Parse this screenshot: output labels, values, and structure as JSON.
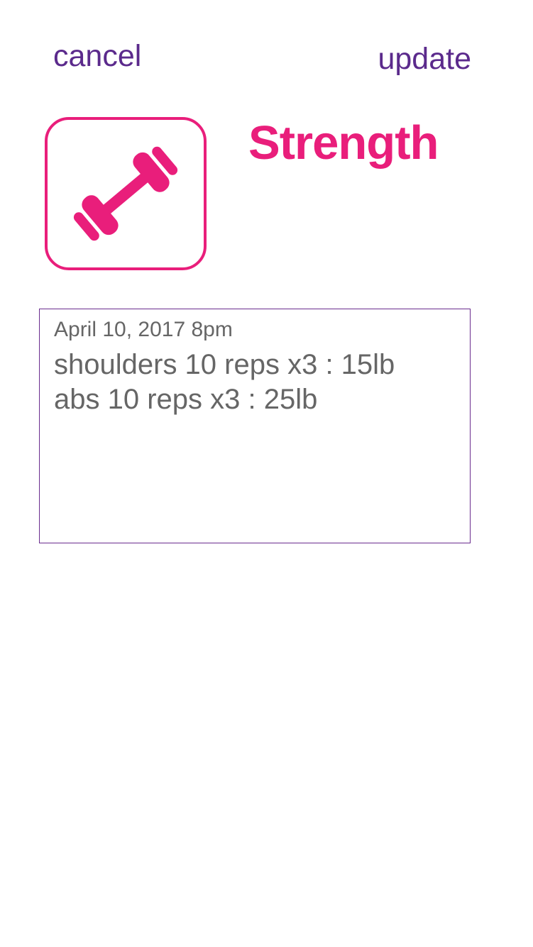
{
  "nav": {
    "cancel_label": "cancel",
    "update_label": "update"
  },
  "activity": {
    "title": "Strength",
    "icon": "dumbbell-icon"
  },
  "entry": {
    "date": "April 10, 2017 8pm",
    "lines": [
      "shoulders 10 reps x3 : 15lb",
      "abs 10 reps x3 : 25lb"
    ]
  },
  "colors": {
    "accent_pink": "#e91e7b",
    "nav_purple": "#5b2a8c",
    "box_border": "#6a2c8e",
    "text_gray": "#666666"
  }
}
